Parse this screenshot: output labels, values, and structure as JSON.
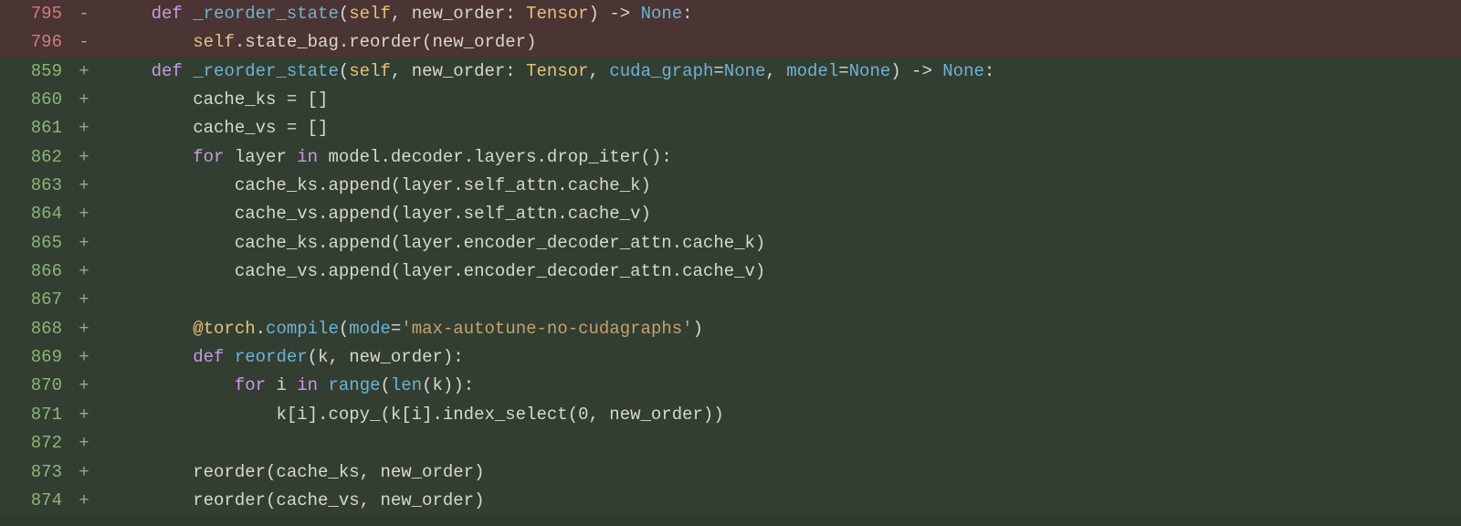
{
  "diff": {
    "lines": [
      {
        "num": "795",
        "type": "removed",
        "marker": "-",
        "indent": "    ",
        "tokens": [
          {
            "cls": "kw",
            "t": "def"
          },
          {
            "cls": "op",
            "t": " "
          },
          {
            "cls": "fn",
            "t": "_reorder_state"
          },
          {
            "cls": "op",
            "t": "("
          },
          {
            "cls": "cls",
            "t": "self"
          },
          {
            "cls": "op",
            "t": ", new_order: "
          },
          {
            "cls": "cls",
            "t": "Tensor"
          },
          {
            "cls": "op",
            "t": ") -> "
          },
          {
            "cls": "type",
            "t": "None"
          },
          {
            "cls": "op",
            "t": ":"
          }
        ]
      },
      {
        "num": "796",
        "type": "removed",
        "marker": "-",
        "indent": "        ",
        "tokens": [
          {
            "cls": "cls",
            "t": "self"
          },
          {
            "cls": "op",
            "t": ".state_bag.reorder(new_order)"
          }
        ]
      },
      {
        "num": "859",
        "type": "added",
        "marker": "+",
        "indent": "    ",
        "tokens": [
          {
            "cls": "kw",
            "t": "def"
          },
          {
            "cls": "op",
            "t": " "
          },
          {
            "cls": "fn",
            "t": "_reorder_state"
          },
          {
            "cls": "op",
            "t": "("
          },
          {
            "cls": "cls",
            "t": "self"
          },
          {
            "cls": "op",
            "t": ", new_order: "
          },
          {
            "cls": "cls",
            "t": "Tensor"
          },
          {
            "cls": "op",
            "t": ", "
          },
          {
            "cls": "fn",
            "t": "cuda_graph"
          },
          {
            "cls": "op",
            "t": "="
          },
          {
            "cls": "type",
            "t": "None"
          },
          {
            "cls": "op",
            "t": ", "
          },
          {
            "cls": "fn",
            "t": "model"
          },
          {
            "cls": "op",
            "t": "="
          },
          {
            "cls": "type",
            "t": "None"
          },
          {
            "cls": "op",
            "t": ") -> "
          },
          {
            "cls": "type",
            "t": "None"
          },
          {
            "cls": "op",
            "t": ":"
          }
        ]
      },
      {
        "num": "860",
        "type": "added",
        "marker": "+",
        "indent": "        ",
        "tokens": [
          {
            "cls": "op",
            "t": "cache_ks = []"
          }
        ]
      },
      {
        "num": "861",
        "type": "added",
        "marker": "+",
        "indent": "        ",
        "tokens": [
          {
            "cls": "op",
            "t": "cache_vs = []"
          }
        ]
      },
      {
        "num": "862",
        "type": "added",
        "marker": "+",
        "indent": "        ",
        "tokens": [
          {
            "cls": "kw",
            "t": "for"
          },
          {
            "cls": "op",
            "t": " layer "
          },
          {
            "cls": "kw",
            "t": "in"
          },
          {
            "cls": "op",
            "t": " model.decoder.layers.drop_iter():"
          }
        ]
      },
      {
        "num": "863",
        "type": "added",
        "marker": "+",
        "indent": "            ",
        "tokens": [
          {
            "cls": "op",
            "t": "cache_ks.append(layer.self_attn.cache_k)"
          }
        ]
      },
      {
        "num": "864",
        "type": "added",
        "marker": "+",
        "indent": "            ",
        "tokens": [
          {
            "cls": "op",
            "t": "cache_vs.append(layer.self_attn.cache_v)"
          }
        ]
      },
      {
        "num": "865",
        "type": "added",
        "marker": "+",
        "indent": "            ",
        "tokens": [
          {
            "cls": "op",
            "t": "cache_ks.append(layer.encoder_decoder_attn.cache_k)"
          }
        ]
      },
      {
        "num": "866",
        "type": "added",
        "marker": "+",
        "indent": "            ",
        "tokens": [
          {
            "cls": "op",
            "t": "cache_vs.append(layer.encoder_decoder_attn.cache_v)"
          }
        ]
      },
      {
        "num": "867",
        "type": "added",
        "marker": "+",
        "indent": "",
        "tokens": []
      },
      {
        "num": "868",
        "type": "added",
        "marker": "+",
        "indent": "        ",
        "tokens": [
          {
            "cls": "cls",
            "t": "@torch"
          },
          {
            "cls": "op",
            "t": "."
          },
          {
            "cls": "fn",
            "t": "compile"
          },
          {
            "cls": "op",
            "t": "("
          },
          {
            "cls": "fn",
            "t": "mode"
          },
          {
            "cls": "op",
            "t": "="
          },
          {
            "cls": "str",
            "t": "'max-autotune-no-cudagraphs'"
          },
          {
            "cls": "op",
            "t": ")"
          }
        ]
      },
      {
        "num": "869",
        "type": "added",
        "marker": "+",
        "indent": "        ",
        "tokens": [
          {
            "cls": "kw",
            "t": "def"
          },
          {
            "cls": "op",
            "t": " "
          },
          {
            "cls": "fn",
            "t": "reorder"
          },
          {
            "cls": "op",
            "t": "(k, new_order):"
          }
        ]
      },
      {
        "num": "870",
        "type": "added",
        "marker": "+",
        "indent": "            ",
        "tokens": [
          {
            "cls": "kw",
            "t": "for"
          },
          {
            "cls": "op",
            "t": " i "
          },
          {
            "cls": "kw",
            "t": "in"
          },
          {
            "cls": "op",
            "t": " "
          },
          {
            "cls": "fn",
            "t": "range"
          },
          {
            "cls": "op",
            "t": "("
          },
          {
            "cls": "fn",
            "t": "len"
          },
          {
            "cls": "op",
            "t": "(k)):"
          }
        ]
      },
      {
        "num": "871",
        "type": "added",
        "marker": "+",
        "indent": "                ",
        "tokens": [
          {
            "cls": "op",
            "t": "k[i].copy_(k[i].index_select("
          },
          {
            "cls": "num",
            "t": "0"
          },
          {
            "cls": "op",
            "t": ", new_order))"
          }
        ]
      },
      {
        "num": "872",
        "type": "added",
        "marker": "+",
        "indent": "",
        "tokens": []
      },
      {
        "num": "873",
        "type": "added",
        "marker": "+",
        "indent": "        ",
        "tokens": [
          {
            "cls": "op",
            "t": "reorder(cache_ks, new_order)"
          }
        ]
      },
      {
        "num": "874",
        "type": "added",
        "marker": "+",
        "indent": "        ",
        "tokens": [
          {
            "cls": "op",
            "t": "reorder(cache_vs, new_order)"
          }
        ]
      }
    ]
  }
}
